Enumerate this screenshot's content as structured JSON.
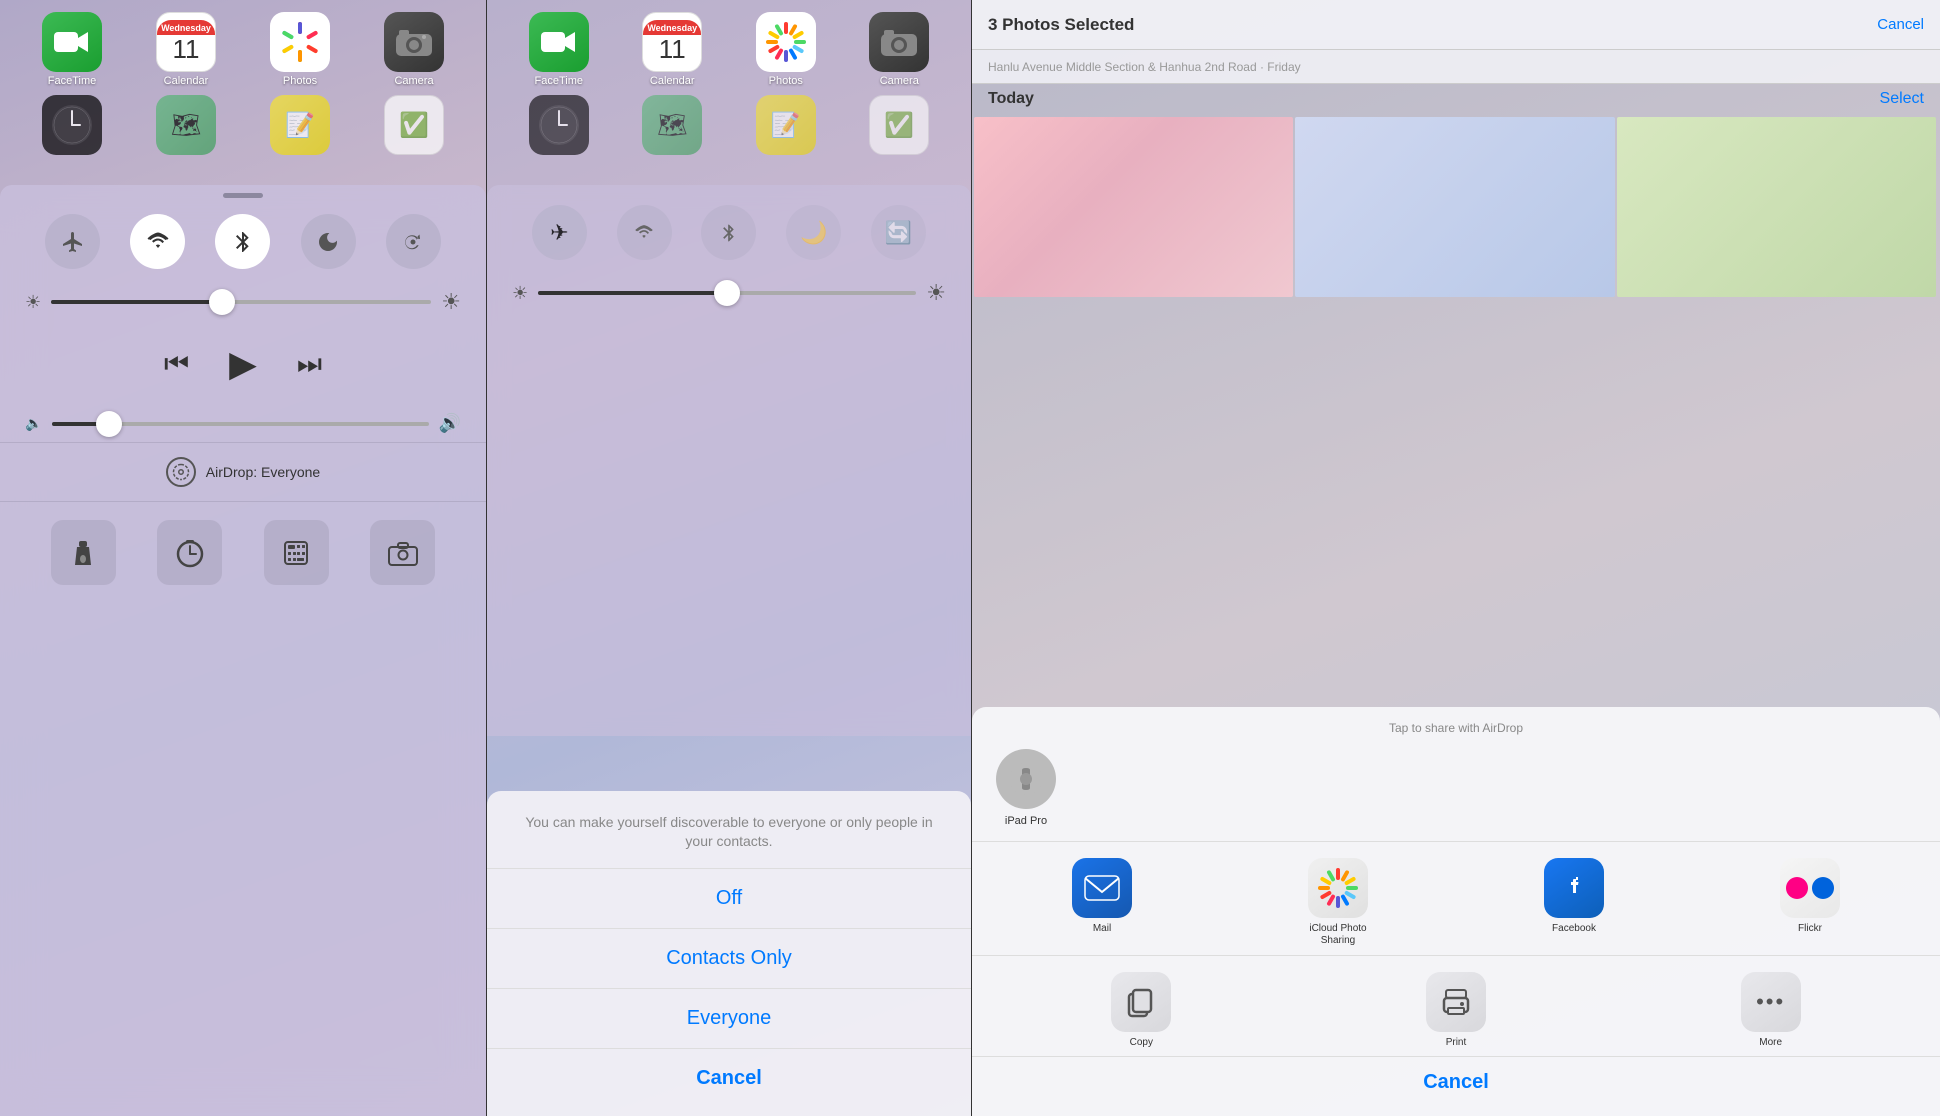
{
  "panel1": {
    "homeIcons": [
      {
        "label": "FaceTime",
        "icon": "facetime"
      },
      {
        "label": "Calendar",
        "icon": "calendar",
        "day": "11",
        "dayName": "Wednesday"
      },
      {
        "label": "Photos",
        "icon": "photos"
      },
      {
        "label": "Camera",
        "icon": "camera"
      }
    ],
    "homeIcons2": [
      {
        "label": "",
        "icon": "clock"
      },
      {
        "label": "",
        "icon": "maps"
      },
      {
        "label": "",
        "icon": "notes"
      },
      {
        "label": "",
        "icon": "reminders"
      }
    ],
    "controls": {
      "airplaneMode": "off",
      "wifi": "on",
      "bluetooth": "on",
      "doNotDisturb": "off",
      "rotation": "off"
    },
    "brightness": {
      "value": 45
    },
    "volume": {
      "value": 15
    },
    "airdrop": {
      "label": "AirDrop: Everyone"
    },
    "quickActions": [
      "flashlight",
      "clock",
      "calculator",
      "camera"
    ]
  },
  "panel2": {
    "homeIcons": [
      {
        "label": "FaceTime"
      },
      {
        "label": "Calendar",
        "day": "11",
        "dayName": "Wednesday"
      },
      {
        "label": "Photos"
      },
      {
        "label": "Camera"
      }
    ],
    "airdropSheet": {
      "message": "You can make yourself discoverable to everyone or only people in your contacts.",
      "options": [
        "Off",
        "Contacts Only",
        "Everyone"
      ],
      "cancelLabel": "Cancel"
    }
  },
  "panel3": {
    "header": {
      "title": "3 Photos Selected",
      "cancelLabel": "Cancel"
    },
    "subheader": "Hanlu Avenue Middle Section & Hanhua 2nd Road · Friday",
    "todayLabel": "Today",
    "selectLabel": "Select",
    "shareSheet": {
      "airdropTitle": "Tap to share with AirDrop",
      "airdropDevice": "iPad Pro",
      "apps": [
        {
          "label": "Mail",
          "icon": "mail"
        },
        {
          "label": "iCloud Photo Sharing",
          "icon": "icloud"
        },
        {
          "label": "Facebook",
          "icon": "facebook"
        },
        {
          "label": "Flickr",
          "icon": "flickr"
        }
      ],
      "actions": [
        {
          "label": "Copy",
          "icon": "copy"
        },
        {
          "label": "Print",
          "icon": "print"
        },
        {
          "label": "More",
          "icon": "more"
        }
      ],
      "cancelLabel": "Cancel"
    }
  }
}
